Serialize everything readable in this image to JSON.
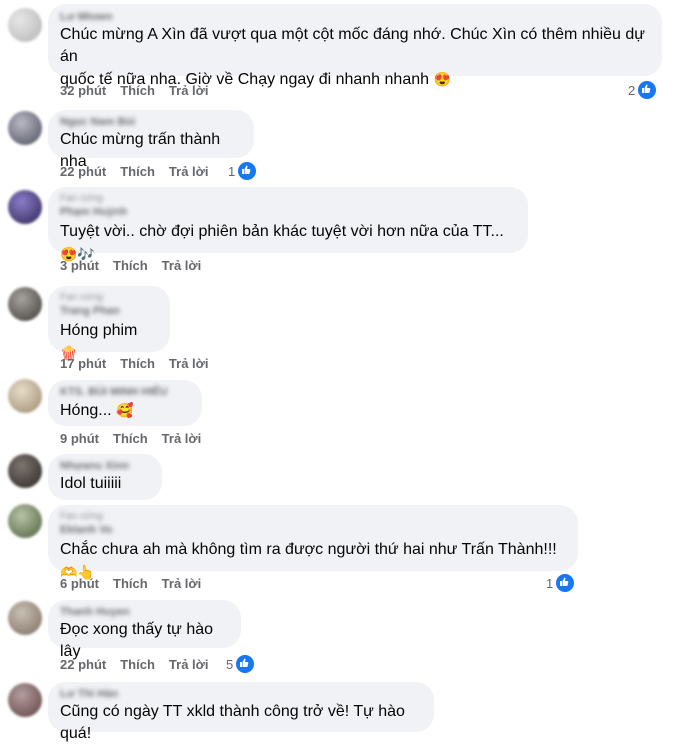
{
  "comments": [
    {
      "tag": "",
      "name": "Lư Mtown",
      "text_l1": "Chúc mừng A Xìn đã vượt qua một cột mốc đáng nhớ. Chúc Xìn có thêm nhiều dự án",
      "text_l2": "quốc tế nữa nha. Giờ về Chạy ngay đi nhanh nhanh",
      "emoji": "😍",
      "time": "32 phút",
      "like": "Thích",
      "reply": "Trả lời",
      "reactions": "2"
    },
    {
      "tag": "",
      "name": "Ngọc Nam Bùi",
      "text": "Chúc mừng trấn thành nha",
      "emoji": "",
      "time": "22 phút",
      "like": "Thích",
      "reply": "Trả lời",
      "reactions": "1"
    },
    {
      "tag": "Fan cứng",
      "name": "Phạm Huỳnh",
      "text": "Tuyệt vời.. chờ đợi phiên bản khác tuyệt vời hơn nữa của TT...",
      "emoji": "😍🎶",
      "time": "3 phút",
      "like": "Thích",
      "reply": "Trả lời",
      "reactions": ""
    },
    {
      "tag": "Fan cứng",
      "name": "Trang Phan",
      "text": "Hóng phim",
      "emoji": "🍿",
      "time": "17 phút",
      "like": "Thích",
      "reply": "Trả lời",
      "reactions": ""
    },
    {
      "tag": "",
      "name": "KTS. BÙI MINH HIẾU",
      "text": "Hóng...",
      "emoji": "🥰",
      "time": "9 phút",
      "like": "Thích",
      "reply": "Trả lời",
      "reactions": ""
    },
    {
      "tag": "",
      "name": "Nhựanu Xinn",
      "text": "Idol tuiiiii",
      "emoji": "",
      "time": "",
      "like": "",
      "reply": "",
      "reactions": ""
    },
    {
      "tag": "Fan cứng",
      "name": "Eklanh Vo",
      "text": "Chắc chưa ah mà không tìm ra được người thứ hai như Trấn Thành!!!",
      "emoji": "🫶👆",
      "time": "6 phút",
      "like": "Thích",
      "reply": "Trả lời",
      "reactions": "1"
    },
    {
      "tag": "",
      "name": "Thanh Huyen",
      "text": "Đọc xong thấy tự hào lây",
      "emoji": "",
      "time": "22 phút",
      "like": "Thích",
      "reply": "Trả lời",
      "reactions": "5"
    },
    {
      "tag": "",
      "name": "Lư Thi Hàn",
      "text": "Cũng có ngày TT xkld thành công trở về! Tự hào quá!",
      "emoji": "",
      "time": "",
      "like": "",
      "reply": "",
      "reactions": ""
    }
  ],
  "colors": {
    "bubble": "#f0f2f5",
    "like_blue": "#1877f2",
    "meta": "#65676b"
  },
  "icons": {
    "reaction": "like-thumb-icon"
  }
}
